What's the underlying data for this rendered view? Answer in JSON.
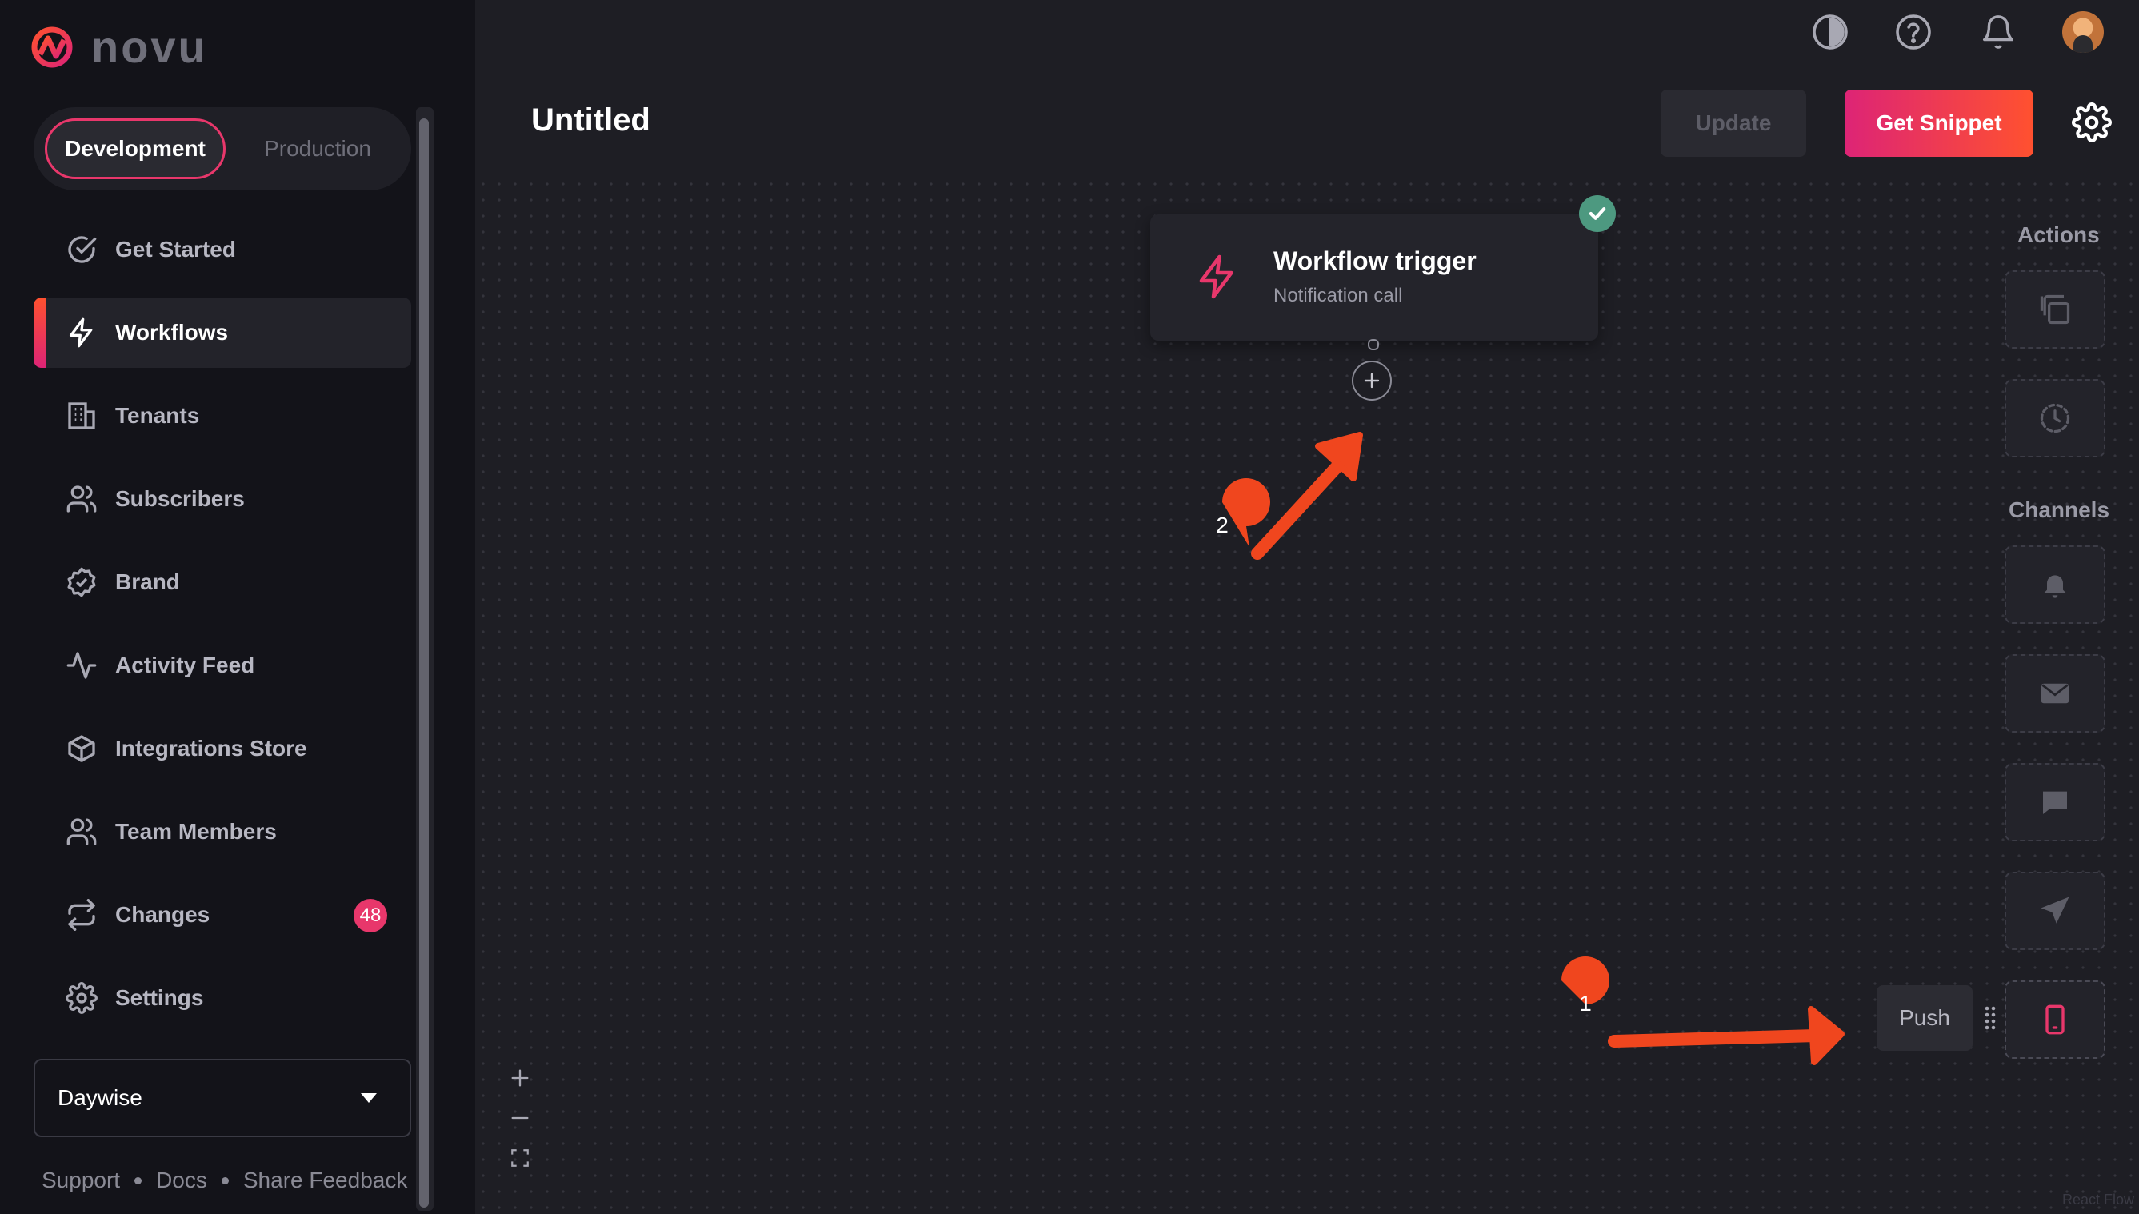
{
  "app": {
    "brand": "novu"
  },
  "env": {
    "development": "Development",
    "production": "Production"
  },
  "nav": {
    "items": [
      {
        "label": "Get Started",
        "icon": "check-circle-icon"
      },
      {
        "label": "Workflows",
        "icon": "bolt-icon",
        "active": true
      },
      {
        "label": "Tenants",
        "icon": "building-icon"
      },
      {
        "label": "Subscribers",
        "icon": "users-icon"
      },
      {
        "label": "Brand",
        "icon": "badge-check-icon"
      },
      {
        "label": "Activity Feed",
        "icon": "activity-icon"
      },
      {
        "label": "Integrations Store",
        "icon": "box-icon"
      },
      {
        "label": "Team Members",
        "icon": "users-icon"
      },
      {
        "label": "Changes",
        "icon": "repeat-icon",
        "badge": "48"
      },
      {
        "label": "Settings",
        "icon": "gear-icon"
      }
    ]
  },
  "org": {
    "name": "Daywise"
  },
  "footer": {
    "support": "Support",
    "docs": "Docs",
    "feedback": "Share Feedback"
  },
  "header": {
    "title": "Untitled",
    "update": "Update",
    "get_snippet": "Get Snippet"
  },
  "trigger": {
    "title": "Workflow trigger",
    "subtitle": "Notification call"
  },
  "panel": {
    "actions_heading": "Actions",
    "channels_heading": "Channels",
    "actions": [
      "digest-icon",
      "delay-icon"
    ],
    "channels": [
      "in-app-bell-icon",
      "email-icon",
      "chat-icon",
      "sms-send-icon",
      "push-mobile-icon"
    ],
    "tooltip": "Push"
  },
  "annotations": {
    "first": "1",
    "second": "2"
  },
  "attribution": "React Flow",
  "colors": {
    "accent": "#e8376b",
    "gradient_start": "#dd2476",
    "gradient_end": "#ff512f",
    "success": "#4d9980",
    "annotation": "#f0461e"
  }
}
